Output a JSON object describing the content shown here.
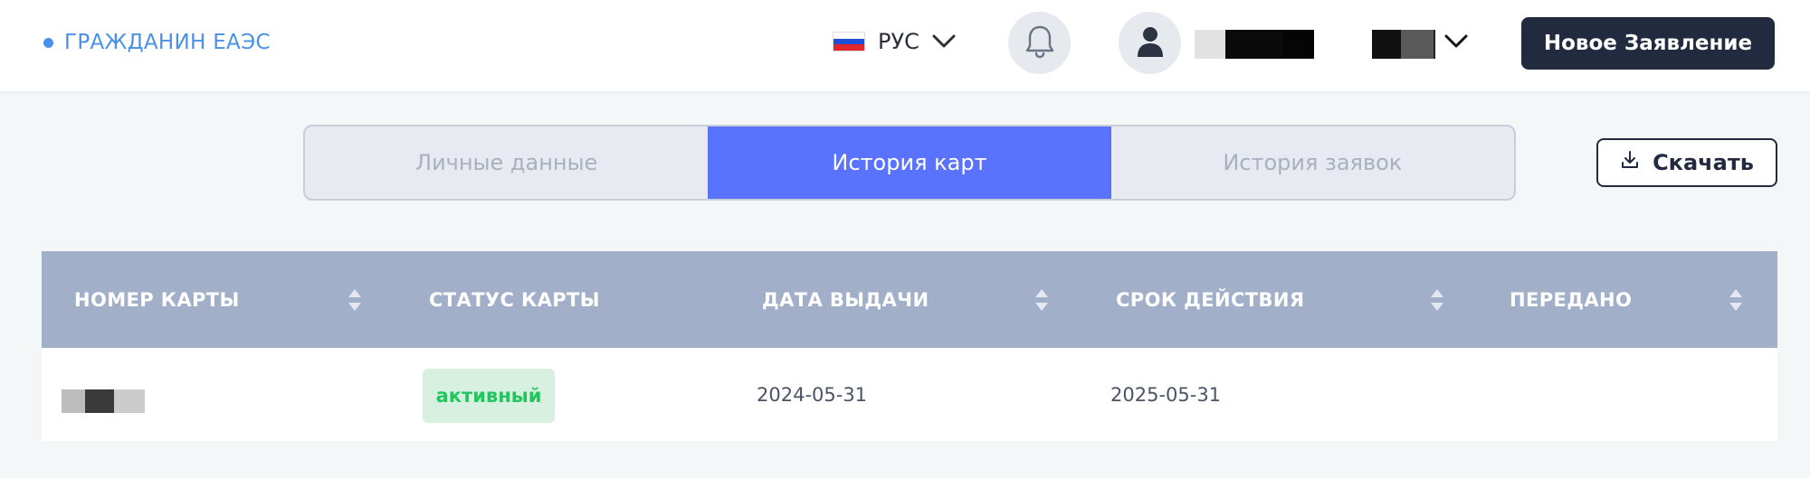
{
  "header": {
    "brand": "ГРАЖДАНИН ЕАЭС",
    "language": "РУС",
    "new_application_label": "Новое Заявление"
  },
  "tabs": [
    {
      "label": "Личные данные",
      "active": false
    },
    {
      "label": "История карт",
      "active": true
    },
    {
      "label": "История заявок",
      "active": false
    }
  ],
  "download_label": "Скачать",
  "table": {
    "columns": [
      "НОМЕР КАРТЫ",
      "СТАТУС КАРТЫ",
      "ДАТА ВЫДАЧИ",
      "СРОК ДЕЙСТВИЯ",
      "ПЕРЕДАНО"
    ],
    "rows": [
      {
        "status": "активный",
        "issue_date": "2024-05-31",
        "expiry_date": "2025-05-31",
        "transferred": ""
      }
    ]
  },
  "colors": {
    "brand": "#4a8fe8",
    "tab_active": "#5a73ff",
    "header_bg": "#a1afc8",
    "primary_button": "#212a3e",
    "status_active_text": "#22c55e",
    "status_active_bg": "#d8f0e0"
  },
  "icons": [
    "russia-flag-icon",
    "chevron-down-icon",
    "bell-icon",
    "user-icon",
    "download-icon",
    "sort-icon"
  ]
}
